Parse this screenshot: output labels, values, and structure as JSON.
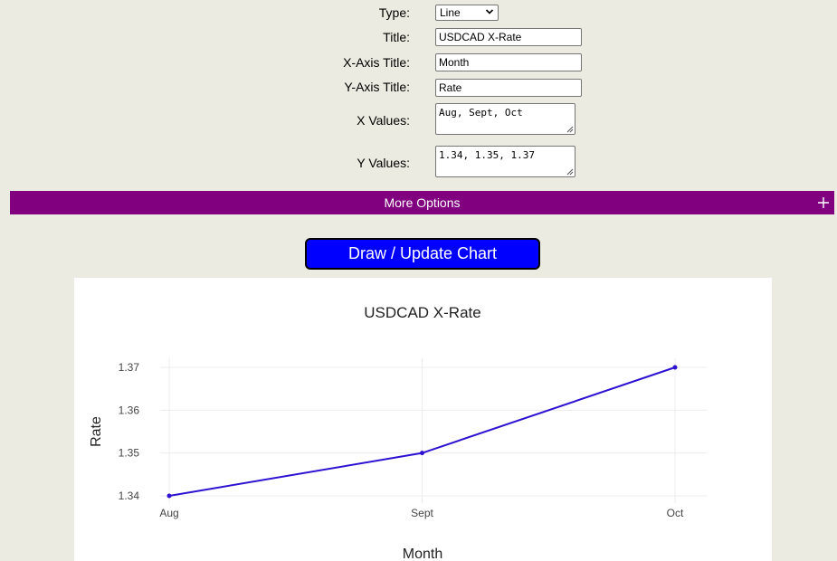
{
  "form": {
    "type_label": "Type:",
    "type_value": "Line",
    "title_label": "Title:",
    "title_value": "USDCAD X-Rate",
    "xaxis_label": "X-Axis Title:",
    "xaxis_value": "Month",
    "yaxis_label": "Y-Axis Title:",
    "yaxis_value": "Rate",
    "xvalues_label": "X Values:",
    "xvalues_value": "Aug, Sept, Oct",
    "yvalues_label": "Y Values:",
    "yvalues_value": "1.34, 1.35, 1.37"
  },
  "more_options": {
    "label": "More Options"
  },
  "draw_button": {
    "label": "Draw / Update Chart"
  },
  "colors": {
    "purple_bar": "#800080",
    "button_blue": "#0000ff",
    "line_color": "#2d12d2"
  },
  "chart_data": {
    "type": "line",
    "title": "USDCAD X-Rate",
    "xlabel": "Month",
    "ylabel": "Rate",
    "categories": [
      "Aug",
      "Sept",
      "Oct"
    ],
    "series": [
      {
        "values": [
          1.34,
          1.35,
          1.37
        ]
      }
    ],
    "ylim": [
      1.34,
      1.37
    ],
    "yticks": [
      1.34,
      1.35,
      1.36,
      1.37
    ],
    "ytick_labels": [
      "1.34",
      "1.35",
      "1.36",
      "1.37"
    ],
    "grid": true
  }
}
